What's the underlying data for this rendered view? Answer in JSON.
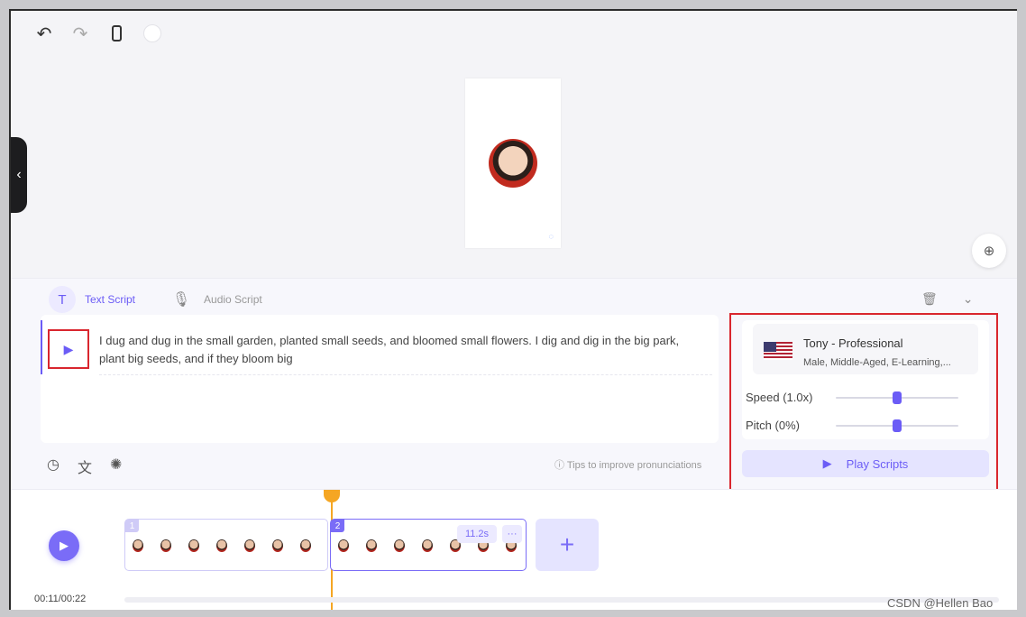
{
  "toolbar": {
    "undo_icon": "undo-icon",
    "redo_icon": "redo-icon",
    "device_icon": "phone-icon",
    "background_icon": "color-circle-icon"
  },
  "editor": {
    "tabs": [
      {
        "label": "Text Script",
        "icon": "text-icon"
      },
      {
        "label": "Audio Script",
        "icon": "mic-icon"
      }
    ],
    "script_text": "I dug and dug in the small garden, planted small seeds, and bloomed small flowers. I dig and dig in the big park, plant big seeds, and if they bloom big",
    "tips": "Tips to improve pronunciations"
  },
  "voice": {
    "name": "Tony - Professional",
    "description": "Male, Middle-Aged, E-Learning,...",
    "speed_label": "Speed (1.0x)",
    "pitch_label": "Pitch (0%)",
    "speed_level": 0.5,
    "pitch_level": 0.5,
    "play_label": "Play Scripts"
  },
  "timeline": {
    "current_time": "00:11/00:22",
    "clips": [
      {
        "number": "1",
        "faces": 7
      },
      {
        "number": "2",
        "faces": 7,
        "duration": "11.2s",
        "more": "···"
      }
    ],
    "add_label": "+"
  },
  "watermark": "CSDN @Hellen Bao",
  "colors": {
    "accent": "#6b5cf6",
    "highlight": "#d9262e",
    "playhead": "#f5a623"
  }
}
